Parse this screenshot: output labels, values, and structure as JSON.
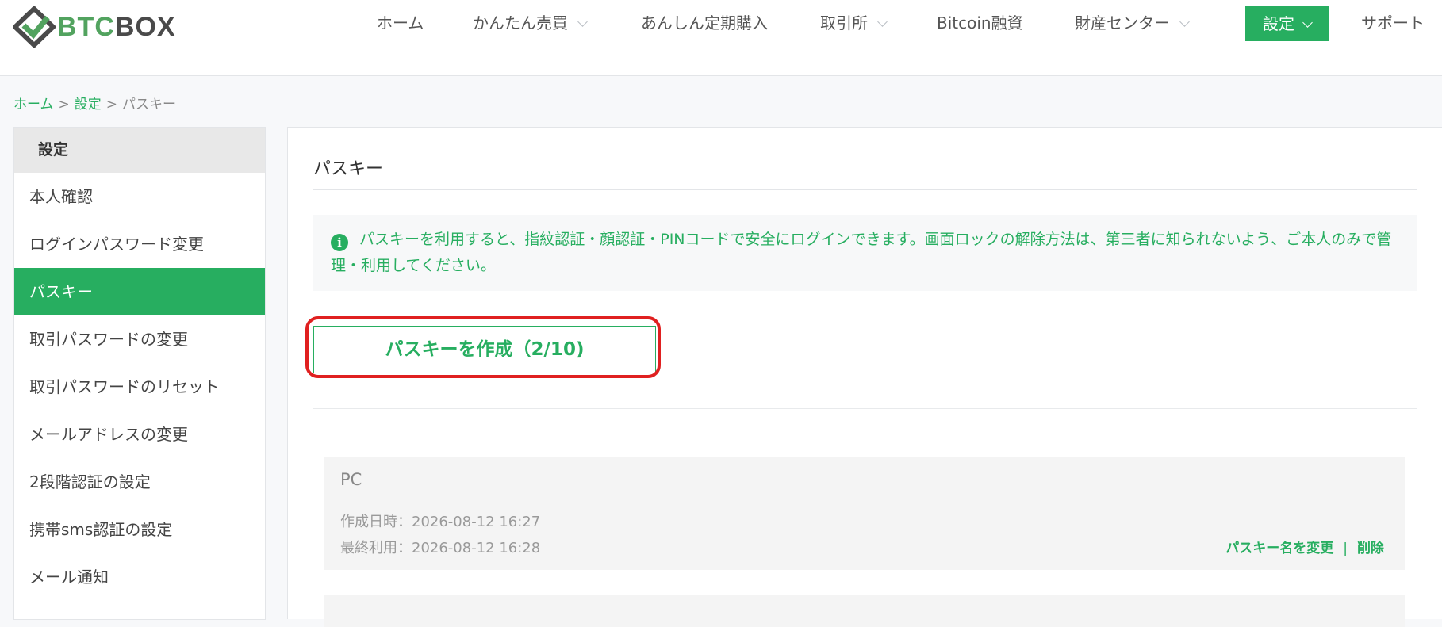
{
  "brand": {
    "logo_text_green": "BTC",
    "logo_text_dark": "BOX",
    "color_green": "#27ae60"
  },
  "nav": {
    "home": "ホーム",
    "easy_trade": "かんたん売買",
    "regular_purchase": "あんしん定期購入",
    "exchange": "取引所",
    "bitcoin_loan": "Bitcoin融資",
    "asset_center": "財産センター",
    "settings": "設定",
    "support": "サポート"
  },
  "breadcrumb": {
    "home": "ホーム",
    "settings": "設定",
    "current": "パスキー",
    "separator": ">"
  },
  "sidebar": {
    "title": "設定",
    "items": [
      {
        "label": "本人確認"
      },
      {
        "label": "ログインパスワード変更"
      },
      {
        "label": "パスキー"
      },
      {
        "label": "取引パスワードの変更"
      },
      {
        "label": "取引パスワードのリセット"
      },
      {
        "label": "メールアドレスの変更"
      },
      {
        "label": "2段階認証の設定"
      },
      {
        "label": "携帯sms認証の設定"
      },
      {
        "label": "メール通知"
      }
    ]
  },
  "main": {
    "title": "パスキー",
    "info_icon": "i",
    "info_text": "パスキーを利用すると、指紋認証・顔認証・PINコードで安全にログインできます。画面ロックの解除方法は、第三者に知られないよう、ご本人のみで管理・利用してください。",
    "create_button": "パスキーを作成（2/10)",
    "passkeys": [
      {
        "name": "PC",
        "created": "作成日時：2026-08-12 16:27",
        "last_used": "最終利用：2026-08-12 16:28",
        "rename_label": "パスキー名を変更",
        "separator": "|",
        "delete_label": "削除"
      }
    ]
  }
}
